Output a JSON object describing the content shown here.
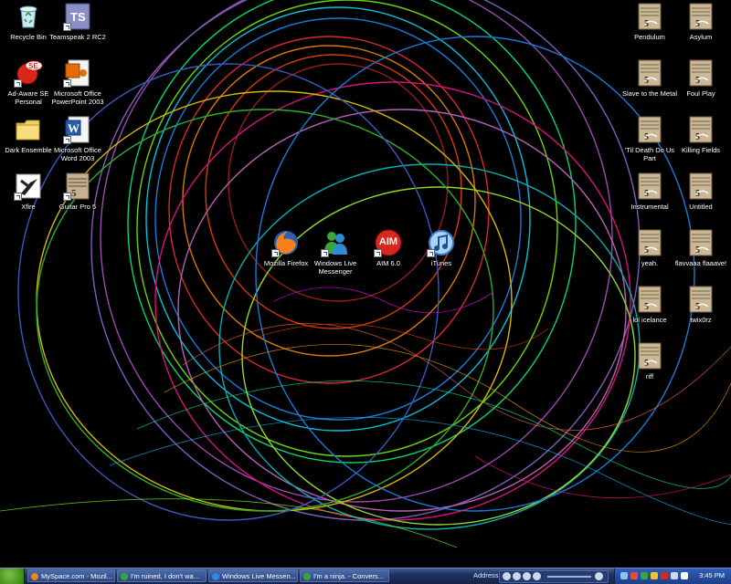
{
  "desktop": {
    "left_icons": [
      {
        "label": "Recycle Bin",
        "icon": "recycle-bin-icon"
      },
      {
        "label": "Teamspeak 2 RC2",
        "icon": "teamspeak-icon"
      },
      {
        "label": "Ad-Aware SE Personal",
        "icon": "ad-aware-icon"
      },
      {
        "label": "Microsoft Office PowerPoint 2003",
        "icon": "powerpoint-icon"
      },
      {
        "label": "Dark Ensemble",
        "icon": "folder-icon"
      },
      {
        "label": "Microsoft Office Word 2003",
        "icon": "word-icon"
      },
      {
        "label": "Xfire",
        "icon": "xfire-icon"
      },
      {
        "label": "Guitar Pro 5",
        "icon": "guitar-pro-icon"
      }
    ],
    "center_icons": [
      {
        "label": "Mozilla Firefox",
        "icon": "firefox-icon"
      },
      {
        "label": "Windows Live Messenger",
        "icon": "messenger-icon"
      },
      {
        "label": "AIM 6.0",
        "icon": "aim-icon",
        "text": "AIM"
      },
      {
        "label": "iTunes",
        "icon": "itunes-icon"
      }
    ],
    "right_icons": [
      {
        "label": "Pendulum"
      },
      {
        "label": "Asylum"
      },
      {
        "label": "Slave to the Metal"
      },
      {
        "label": "Foul Play"
      },
      {
        "label": "'Til Death Do Us Part"
      },
      {
        "label": "Killing Fields"
      },
      {
        "label": "Instrumental"
      },
      {
        "label": "Untitled"
      },
      {
        "label": "yeah."
      },
      {
        "label": "flavvaaa flaaave!"
      },
      {
        "label": "lol icelance"
      },
      {
        "label": "twix0rz"
      },
      {
        "label": "riff"
      }
    ]
  },
  "taskbar": {
    "tasks": [
      {
        "label": "MySpace.com - Mozil..."
      },
      {
        "label": "I'm ruined, I don't wa..."
      },
      {
        "label": "Windows Live Messen..."
      },
      {
        "label": "I'm a ninja. - Convers..."
      }
    ],
    "address_label": "Address",
    "clock": "3:45 PM"
  },
  "colors": {
    "taskbar": "#1f3160",
    "tray": "#1c3f88",
    "background": "#000000"
  }
}
